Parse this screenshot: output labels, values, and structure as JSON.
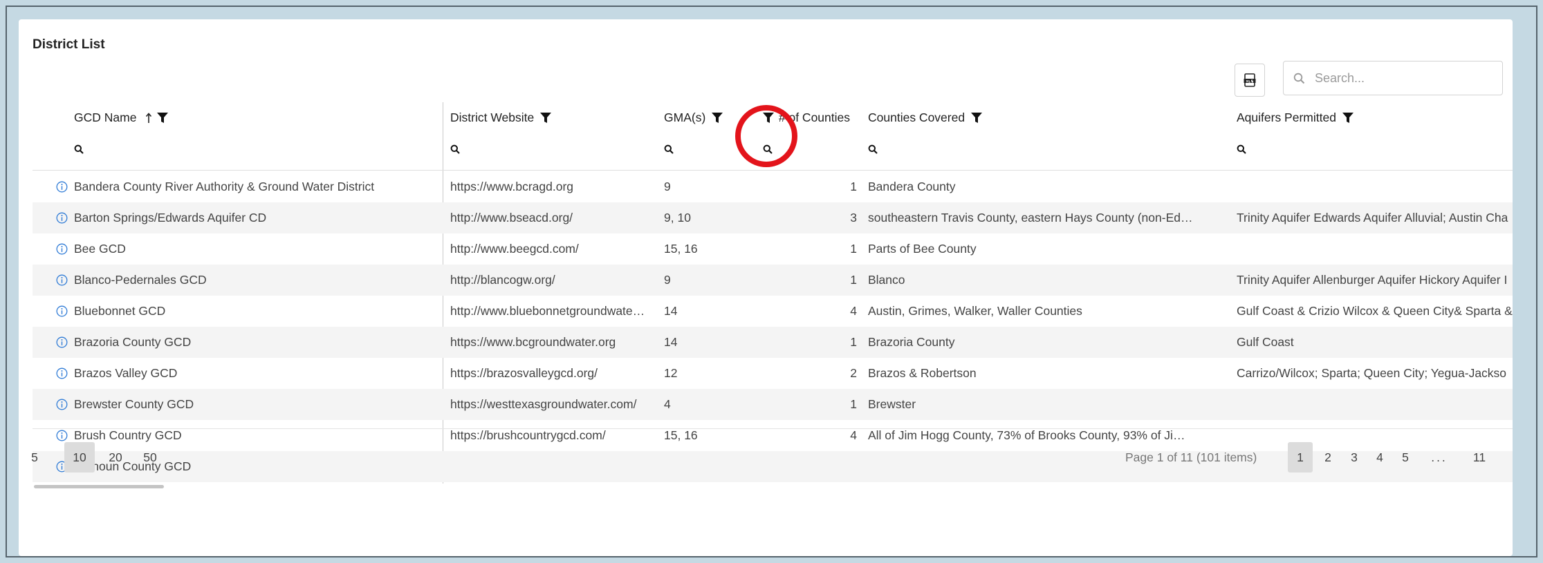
{
  "title": "District List",
  "search": {
    "placeholder": "Search..."
  },
  "columns": {
    "gcd_name": "GCD Name",
    "district_website": "District Website",
    "gma": "GMA(s)",
    "num_counties": "# of Counties",
    "counties_covered": "Counties Covered",
    "aquifers": "Aquifers Permitted"
  },
  "rows": [
    {
      "name": "Bandera County River Authority & Ground Water District",
      "website": "https://www.bcragd.org",
      "gma": "9",
      "counties": "1",
      "covered": "Bandera County",
      "aquifers": ""
    },
    {
      "name": "Barton Springs/Edwards Aquifer CD",
      "website": "http://www.bseacd.org/",
      "gma": "9, 10",
      "counties": "3",
      "covered": "southeastern Travis County, eastern Hays County (non-Ed…",
      "aquifers": "Trinity Aquifer Edwards Aquifer Alluvial; Austin Cha"
    },
    {
      "name": "Bee GCD",
      "website": "http://www.beegcd.com/",
      "gma": "15, 16",
      "counties": "1",
      "covered": "Parts of Bee County",
      "aquifers": ""
    },
    {
      "name": "Blanco-Pedernales GCD",
      "website": "http://blancogw.org/",
      "gma": "9",
      "counties": "1",
      "covered": "Blanco",
      "aquifers": "Trinity Aquifer Allenburger Aquifer Hickory Aquifer I"
    },
    {
      "name": "Bluebonnet GCD",
      "website": "http://www.bluebonnetgroundwate…",
      "gma": "14",
      "counties": "4",
      "covered": "Austin, Grimes, Walker, Waller Counties",
      "aquifers": "Gulf Coast & Crizio Wilcox & Queen City& Sparta &"
    },
    {
      "name": "Brazoria County GCD",
      "website": "https://www.bcgroundwater.org",
      "gma": "14",
      "counties": "1",
      "covered": "Brazoria County",
      "aquifers": "Gulf Coast"
    },
    {
      "name": "Brazos Valley GCD",
      "website": "https://brazosvalleygcd.org/",
      "gma": "12",
      "counties": "2",
      "covered": "Brazos & Robertson",
      "aquifers": "Carrizo/Wilcox; Sparta; Queen City; Yegua-Jackso"
    },
    {
      "name": "Brewster County GCD",
      "website": "https://westtexasgroundwater.com/",
      "gma": "4",
      "counties": "1",
      "covered": "Brewster",
      "aquifers": ""
    },
    {
      "name": "Brush Country GCD",
      "website": "https://brushcountrygcd.com/",
      "gma": "15, 16",
      "counties": "4",
      "covered": "All of Jim Hogg County, 73% of Brooks County, 93% of Ji…",
      "aquifers": ""
    },
    {
      "name": "Calhoun County GCD",
      "website": "",
      "gma": "",
      "counties": "",
      "covered": "",
      "aquifers": ""
    }
  ],
  "page_sizes": [
    "5",
    "10",
    "20",
    "50"
  ],
  "selected_page_size": "10",
  "pager": {
    "info": "Page 1 of 11 (101 items)",
    "pages": [
      "1",
      "2",
      "3",
      "4",
      "5",
      "...",
      "11"
    ],
    "current": "1"
  },
  "icons": {
    "export": "xlsx-export-icon",
    "search": "search-icon",
    "filter": "filter-funnel-icon",
    "sort": "sort-ascending-icon",
    "info": "info-circle-icon"
  },
  "colors": {
    "background": "#c5d9e3",
    "highlight_ring": "#e3141b",
    "info_icon": "#2f7bd6",
    "selected_pill": "#dcdcdc"
  }
}
